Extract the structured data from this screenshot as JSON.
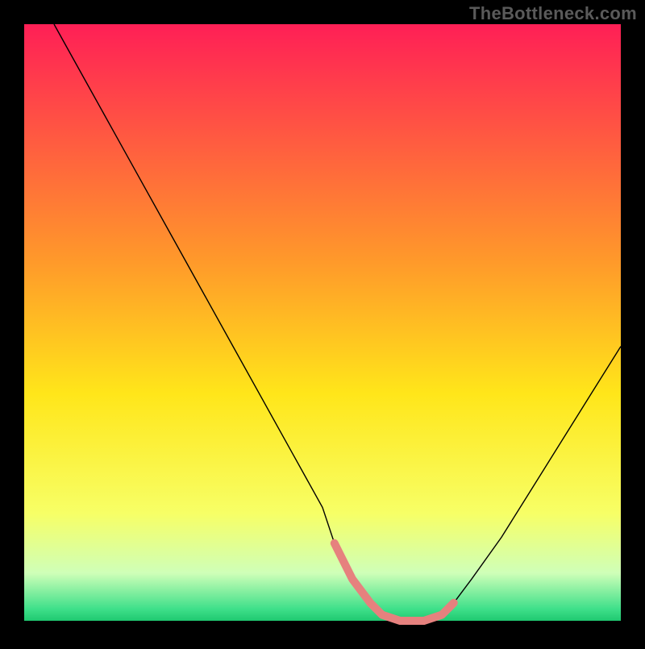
{
  "watermark": "TheBottleneck.com",
  "chart_data": {
    "type": "line",
    "title": "",
    "xlabel": "",
    "ylabel": "",
    "xlim": [
      0,
      100
    ],
    "ylim": [
      0,
      100
    ],
    "grid": false,
    "legend": false,
    "background_gradient": {
      "stops": [
        {
          "offset": 0.0,
          "color": "#ff1f56"
        },
        {
          "offset": 0.4,
          "color": "#ff9a2a"
        },
        {
          "offset": 0.62,
          "color": "#ffe61a"
        },
        {
          "offset": 0.82,
          "color": "#f7ff66"
        },
        {
          "offset": 0.92,
          "color": "#cfffb8"
        },
        {
          "offset": 0.98,
          "color": "#3fe08a"
        },
        {
          "offset": 1.0,
          "color": "#1fc870"
        }
      ]
    },
    "series": [
      {
        "name": "bottleneck-curve",
        "stroke": "#000000",
        "stroke_width": 1.4,
        "x": [
          5,
          10,
          15,
          20,
          25,
          30,
          35,
          40,
          45,
          50,
          52,
          55,
          58,
          60,
          63,
          67,
          70,
          72,
          75,
          80,
          85,
          90,
          95,
          100
        ],
        "y": [
          100,
          91,
          82,
          73,
          64,
          55,
          46,
          37,
          28,
          19,
          13,
          7,
          3,
          1,
          0,
          0,
          1,
          3,
          7,
          14,
          22,
          30,
          38,
          46
        ]
      },
      {
        "name": "highlight-band",
        "stroke": "#e6817e",
        "stroke_width": 10,
        "linecap": "round",
        "x": [
          52,
          55,
          58,
          60,
          63,
          67,
          70,
          72
        ],
        "y": [
          13,
          7,
          3,
          1,
          0,
          0,
          1,
          3
        ]
      }
    ]
  }
}
